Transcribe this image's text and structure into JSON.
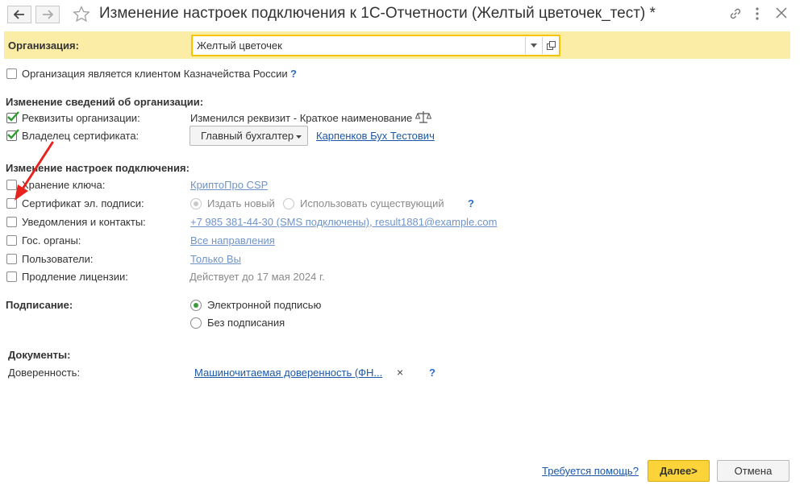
{
  "window": {
    "title": "Изменение настроек подключения к 1С-Отчетности (Желтый цветочек_тест) *",
    "back_icon": "arrow-left-icon",
    "forward_icon": "arrow-right-icon",
    "favorite_icon": "star-icon",
    "link_icon": "link-icon",
    "more_icon": "more-icon",
    "close_icon": "close-icon"
  },
  "organization": {
    "label": "Организация:",
    "value": "Желтый цветочек",
    "highlight_color": "#fbeca6"
  },
  "treasury": {
    "label": "Организация является клиентом Казначейства России",
    "help": "?"
  },
  "org_changes": {
    "heading": "Изменение сведений об организации:",
    "requisites_label": "Реквизиты организации:",
    "requisites_value": "Изменился реквизит - Краткое наименование",
    "owner_label": "Владелец сертификата:",
    "owner_role": "Главный бухгалтер",
    "owner_person": "Карпенков Бух Тестович"
  },
  "connection": {
    "heading": "Изменение настроек подключения:",
    "key_storage_label": "Хранение ключа:",
    "key_storage_value": "КриптоПро CSP",
    "cert_label": "Сертификат эл. подписи:",
    "cert_option_new": "Издать новый",
    "cert_option_existing": "Использовать существующий",
    "cert_help": "?",
    "notify_label": "Уведомления и контакты:",
    "notify_value": "+7 985 381-44-30 (SMS подключены), result1881@example.com",
    "gov_label": "Гос. органы:",
    "gov_value": "Все направления",
    "users_label": "Пользователи:",
    "users_value": "Только Вы",
    "license_label": "Продление лицензии:",
    "license_value": "Действует до 17 мая 2024 г."
  },
  "signing": {
    "label": "Подписание:",
    "option_electronic": "Электронной подписью",
    "option_none": "Без подписания"
  },
  "documents": {
    "heading": "Документы:",
    "poa_label": "Доверенность:",
    "poa_value": "Машиночитаемая доверенность (ФН...",
    "clear": "×",
    "help": "?"
  },
  "footer": {
    "help_link": "Требуется помощь?",
    "next": "Далее>",
    "cancel": "Отмена",
    "accent": "#fcd43a"
  }
}
